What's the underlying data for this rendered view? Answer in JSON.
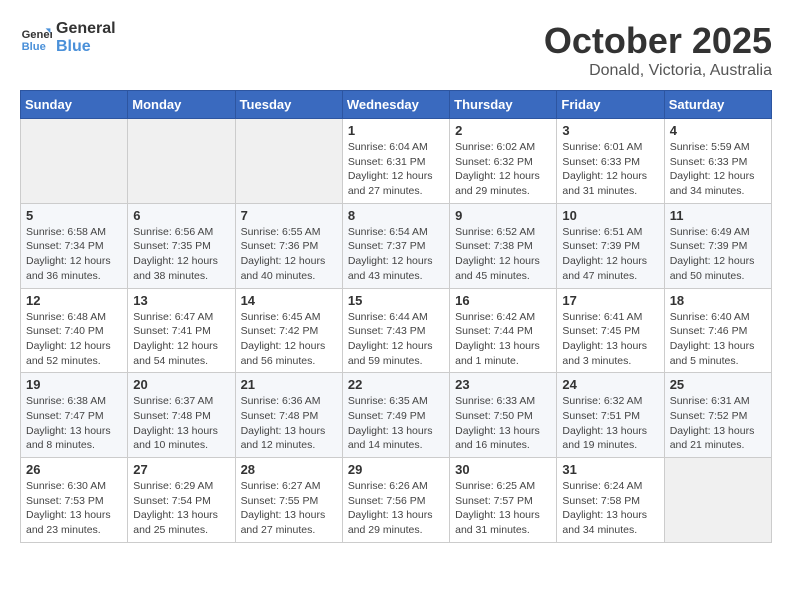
{
  "header": {
    "logo_line1": "General",
    "logo_line2": "Blue",
    "month": "October 2025",
    "location": "Donald, Victoria, Australia"
  },
  "days_of_week": [
    "Sunday",
    "Monday",
    "Tuesday",
    "Wednesday",
    "Thursday",
    "Friday",
    "Saturday"
  ],
  "weeks": [
    [
      {
        "day": "",
        "info": ""
      },
      {
        "day": "",
        "info": ""
      },
      {
        "day": "",
        "info": ""
      },
      {
        "day": "1",
        "info": "Sunrise: 6:04 AM\nSunset: 6:31 PM\nDaylight: 12 hours\nand 27 minutes."
      },
      {
        "day": "2",
        "info": "Sunrise: 6:02 AM\nSunset: 6:32 PM\nDaylight: 12 hours\nand 29 minutes."
      },
      {
        "day": "3",
        "info": "Sunrise: 6:01 AM\nSunset: 6:33 PM\nDaylight: 12 hours\nand 31 minutes."
      },
      {
        "day": "4",
        "info": "Sunrise: 5:59 AM\nSunset: 6:33 PM\nDaylight: 12 hours\nand 34 minutes."
      }
    ],
    [
      {
        "day": "5",
        "info": "Sunrise: 6:58 AM\nSunset: 7:34 PM\nDaylight: 12 hours\nand 36 minutes."
      },
      {
        "day": "6",
        "info": "Sunrise: 6:56 AM\nSunset: 7:35 PM\nDaylight: 12 hours\nand 38 minutes."
      },
      {
        "day": "7",
        "info": "Sunrise: 6:55 AM\nSunset: 7:36 PM\nDaylight: 12 hours\nand 40 minutes."
      },
      {
        "day": "8",
        "info": "Sunrise: 6:54 AM\nSunset: 7:37 PM\nDaylight: 12 hours\nand 43 minutes."
      },
      {
        "day": "9",
        "info": "Sunrise: 6:52 AM\nSunset: 7:38 PM\nDaylight: 12 hours\nand 45 minutes."
      },
      {
        "day": "10",
        "info": "Sunrise: 6:51 AM\nSunset: 7:39 PM\nDaylight: 12 hours\nand 47 minutes."
      },
      {
        "day": "11",
        "info": "Sunrise: 6:49 AM\nSunset: 7:39 PM\nDaylight: 12 hours\nand 50 minutes."
      }
    ],
    [
      {
        "day": "12",
        "info": "Sunrise: 6:48 AM\nSunset: 7:40 PM\nDaylight: 12 hours\nand 52 minutes."
      },
      {
        "day": "13",
        "info": "Sunrise: 6:47 AM\nSunset: 7:41 PM\nDaylight: 12 hours\nand 54 minutes."
      },
      {
        "day": "14",
        "info": "Sunrise: 6:45 AM\nSunset: 7:42 PM\nDaylight: 12 hours\nand 56 minutes."
      },
      {
        "day": "15",
        "info": "Sunrise: 6:44 AM\nSunset: 7:43 PM\nDaylight: 12 hours\nand 59 minutes."
      },
      {
        "day": "16",
        "info": "Sunrise: 6:42 AM\nSunset: 7:44 PM\nDaylight: 13 hours\nand 1 minute."
      },
      {
        "day": "17",
        "info": "Sunrise: 6:41 AM\nSunset: 7:45 PM\nDaylight: 13 hours\nand 3 minutes."
      },
      {
        "day": "18",
        "info": "Sunrise: 6:40 AM\nSunset: 7:46 PM\nDaylight: 13 hours\nand 5 minutes."
      }
    ],
    [
      {
        "day": "19",
        "info": "Sunrise: 6:38 AM\nSunset: 7:47 PM\nDaylight: 13 hours\nand 8 minutes."
      },
      {
        "day": "20",
        "info": "Sunrise: 6:37 AM\nSunset: 7:48 PM\nDaylight: 13 hours\nand 10 minutes."
      },
      {
        "day": "21",
        "info": "Sunrise: 6:36 AM\nSunset: 7:48 PM\nDaylight: 13 hours\nand 12 minutes."
      },
      {
        "day": "22",
        "info": "Sunrise: 6:35 AM\nSunset: 7:49 PM\nDaylight: 13 hours\nand 14 minutes."
      },
      {
        "day": "23",
        "info": "Sunrise: 6:33 AM\nSunset: 7:50 PM\nDaylight: 13 hours\nand 16 minutes."
      },
      {
        "day": "24",
        "info": "Sunrise: 6:32 AM\nSunset: 7:51 PM\nDaylight: 13 hours\nand 19 minutes."
      },
      {
        "day": "25",
        "info": "Sunrise: 6:31 AM\nSunset: 7:52 PM\nDaylight: 13 hours\nand 21 minutes."
      }
    ],
    [
      {
        "day": "26",
        "info": "Sunrise: 6:30 AM\nSunset: 7:53 PM\nDaylight: 13 hours\nand 23 minutes."
      },
      {
        "day": "27",
        "info": "Sunrise: 6:29 AM\nSunset: 7:54 PM\nDaylight: 13 hours\nand 25 minutes."
      },
      {
        "day": "28",
        "info": "Sunrise: 6:27 AM\nSunset: 7:55 PM\nDaylight: 13 hours\nand 27 minutes."
      },
      {
        "day": "29",
        "info": "Sunrise: 6:26 AM\nSunset: 7:56 PM\nDaylight: 13 hours\nand 29 minutes."
      },
      {
        "day": "30",
        "info": "Sunrise: 6:25 AM\nSunset: 7:57 PM\nDaylight: 13 hours\nand 31 minutes."
      },
      {
        "day": "31",
        "info": "Sunrise: 6:24 AM\nSunset: 7:58 PM\nDaylight: 13 hours\nand 34 minutes."
      },
      {
        "day": "",
        "info": ""
      }
    ]
  ]
}
